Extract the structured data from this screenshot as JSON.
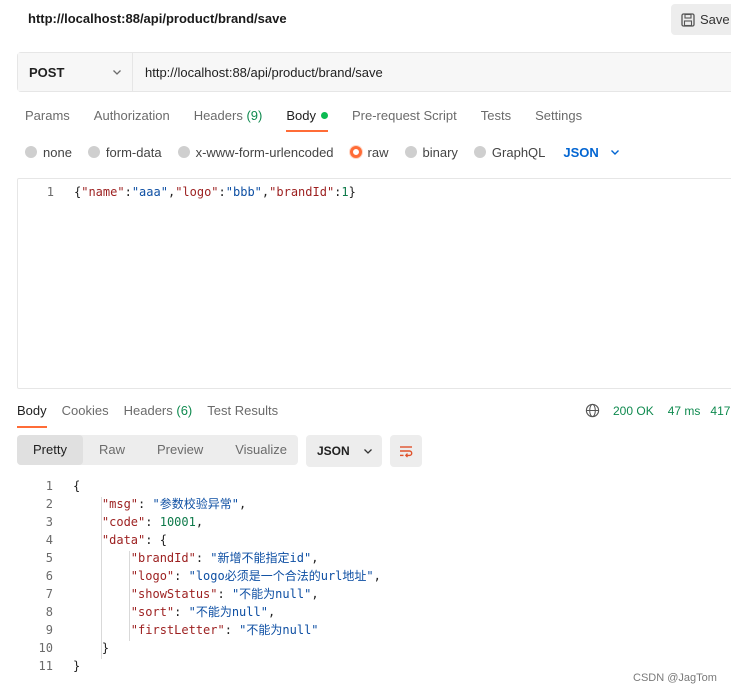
{
  "window": {
    "title": "http://localhost:88/api/product/brand/save",
    "save_label": "Save"
  },
  "request": {
    "method": "POST",
    "url": "http://localhost:88/api/product/brand/save"
  },
  "request_tabs": [
    {
      "label": "Params"
    },
    {
      "label": "Authorization"
    },
    {
      "label": "Headers",
      "count": "(9)"
    },
    {
      "label": "Body"
    },
    {
      "label": "Pre-request Script"
    },
    {
      "label": "Tests"
    },
    {
      "label": "Settings"
    }
  ],
  "body_types": [
    "none",
    "form-data",
    "x-www-form-urlencoded",
    "raw",
    "binary",
    "GraphQL"
  ],
  "body_type_selected": "raw",
  "raw_format": "JSON",
  "request_body": {
    "line_number": "1",
    "text": "{\"name\":\"aaa\",\"logo\":\"bbb\",\"brandId\":1}"
  },
  "response_tabs": [
    {
      "label": "Body"
    },
    {
      "label": "Cookies"
    },
    {
      "label": "Headers",
      "count": "(6)"
    },
    {
      "label": "Test Results"
    }
  ],
  "response_status": {
    "status": "200 OK",
    "time": "47 ms",
    "size": "417"
  },
  "view_modes": [
    "Pretty",
    "Raw",
    "Preview",
    "Visualize"
  ],
  "response_format": "JSON",
  "response_lines": [
    {
      "n": "1",
      "t": "{"
    },
    {
      "n": "2",
      "t": "    \"msg\": \"参数校验异常\","
    },
    {
      "n": "3",
      "t": "    \"code\": 10001,"
    },
    {
      "n": "4",
      "t": "    \"data\": {"
    },
    {
      "n": "5",
      "t": "        \"brandId\": \"新增不能指定id\","
    },
    {
      "n": "6",
      "t": "        \"logo\": \"logo必须是一个合法的url地址\","
    },
    {
      "n": "7",
      "t": "        \"showStatus\": \"不能为null\","
    },
    {
      "n": "8",
      "t": "        \"sort\": \"不能为null\","
    },
    {
      "n": "9",
      "t": "        \"firstLetter\": \"不能为null\""
    },
    {
      "n": "10",
      "t": "    }"
    },
    {
      "n": "11",
      "t": "}"
    }
  ],
  "watermark": "CSDN @JagTom"
}
